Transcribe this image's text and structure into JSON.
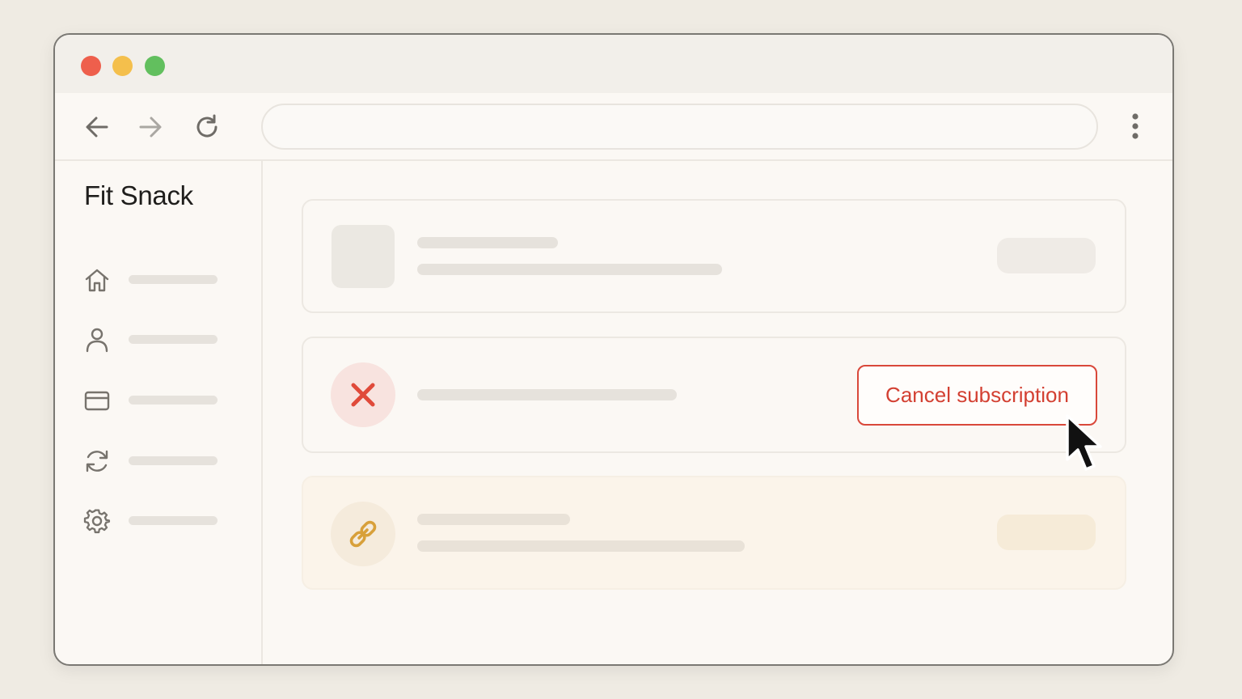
{
  "window": {
    "controls": [
      "close",
      "minimize",
      "maximize"
    ]
  },
  "toolbar": {
    "back_icon": "arrow-left-icon",
    "forward_icon": "arrow-right-icon",
    "reload_icon": "reload-icon",
    "address_value": "",
    "menu_icon": "more-vertical-icon"
  },
  "sidebar": {
    "app_title": "Fit Snack",
    "items": [
      {
        "icon": "home-icon"
      },
      {
        "icon": "user-icon"
      },
      {
        "icon": "card-icon"
      },
      {
        "icon": "refresh-icon"
      },
      {
        "icon": "gear-icon"
      }
    ]
  },
  "main": {
    "cards": [
      {
        "kind": "placeholder"
      },
      {
        "kind": "cancel",
        "icon": "close-x-icon",
        "button_label": "Cancel subscription"
      },
      {
        "kind": "link",
        "icon": "link-icon"
      }
    ]
  },
  "colors": {
    "accent_red": "#d9483a",
    "accent_gold": "#d8a03a",
    "background": "#efebe3"
  }
}
